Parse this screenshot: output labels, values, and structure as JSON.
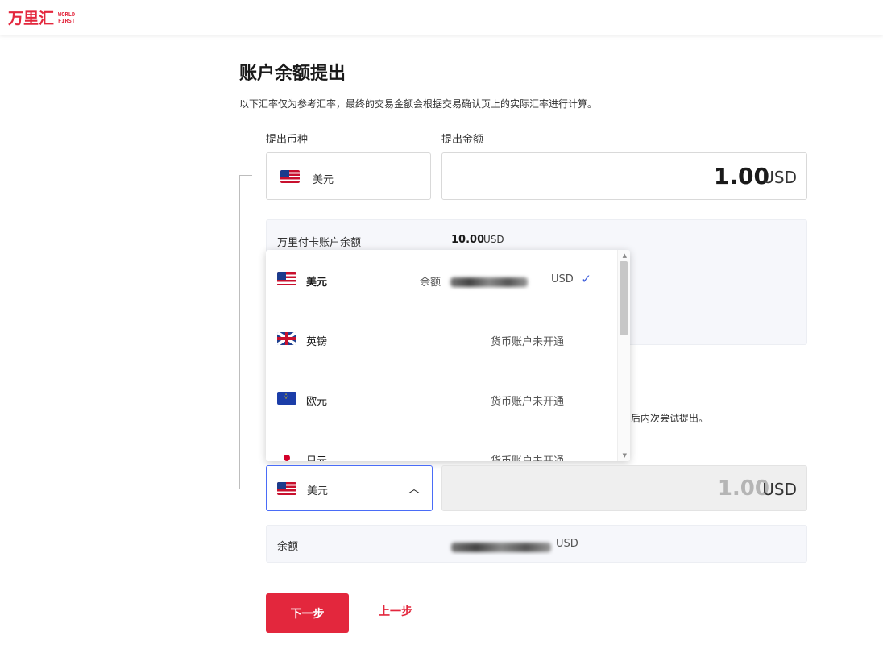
{
  "header": {
    "logo_cn": "万里汇",
    "logo_en_top": "WORLD",
    "logo_en_bottom": "FIRST"
  },
  "page": {
    "title": "账户余额提出",
    "description": "以下汇率仅为参考汇率，最终的交易金额会根据交易确认页上的实际汇率进行计算。"
  },
  "source": {
    "currency_label": "提出币种",
    "amount_label": "提出金额",
    "currency": "美元",
    "amount": "1.00",
    "unit": "USD"
  },
  "info": {
    "account_label": "万里付卡账户余额",
    "account_amount": "10.00",
    "account_unit": "USD",
    "partial_note": "后内次尝试提出。"
  },
  "dropdown": {
    "items": [
      {
        "flag": "us-flag-icon",
        "name": "美元",
        "balance_prefix": "余额",
        "unit": "USD",
        "selected": true
      },
      {
        "flag": "gb-flag-icon",
        "name": "英镑",
        "status": "货币账户未开通"
      },
      {
        "flag": "eu-flag-icon",
        "name": "欧元",
        "status": "货币账户未开通"
      },
      {
        "flag": "jp-flag-icon",
        "name": "日元",
        "status": "货币账户未开通"
      }
    ]
  },
  "target": {
    "currency": "美元",
    "amount": "1.00",
    "unit": "USD"
  },
  "balance": {
    "label": "余额",
    "unit": "USD"
  },
  "buttons": {
    "next": "下一步",
    "prev": "上一步"
  },
  "colors": {
    "brand": "#e3273d",
    "focus": "#4a6cf7",
    "check": "#3b5bdb"
  }
}
